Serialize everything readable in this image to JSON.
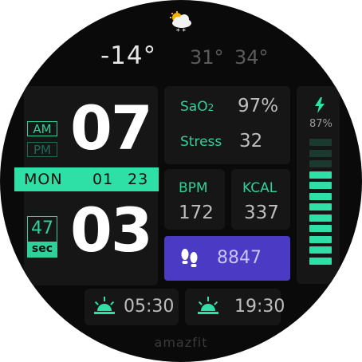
{
  "weather": {
    "icon": "cloud-snow-icon",
    "current_temp": "-14°",
    "low_temp": "31°",
    "high_temp": "34°"
  },
  "time": {
    "am_label": "AM",
    "pm_label": "PM",
    "hour": "07",
    "minute": "03",
    "seconds": "47",
    "seconds_label": "sec"
  },
  "date": {
    "weekday": "MON",
    "month": "01",
    "day": "23"
  },
  "health": {
    "sao2_label": "SaO2",
    "sao2_value": "97%",
    "stress_label": "Stress",
    "stress_value": "32",
    "bpm_label": "BPM",
    "bpm_value": "172",
    "kcal_label": "KCAL",
    "kcal_value": "337"
  },
  "steps": {
    "icon": "footprints-icon",
    "value": "8847"
  },
  "battery": {
    "icon": "lightning-icon",
    "percent_label": "87%",
    "level": 0.87
  },
  "sun": {
    "sunrise_icon": "sunrise-icon",
    "sunrise": "05:30",
    "sunset_icon": "sunset-icon",
    "sunset": "19:30"
  },
  "brand": "amazfit",
  "colors": {
    "accent": "#2ee0a6",
    "steps_bg": "#4a3ac4",
    "battery_empty": "#1a3a30"
  }
}
